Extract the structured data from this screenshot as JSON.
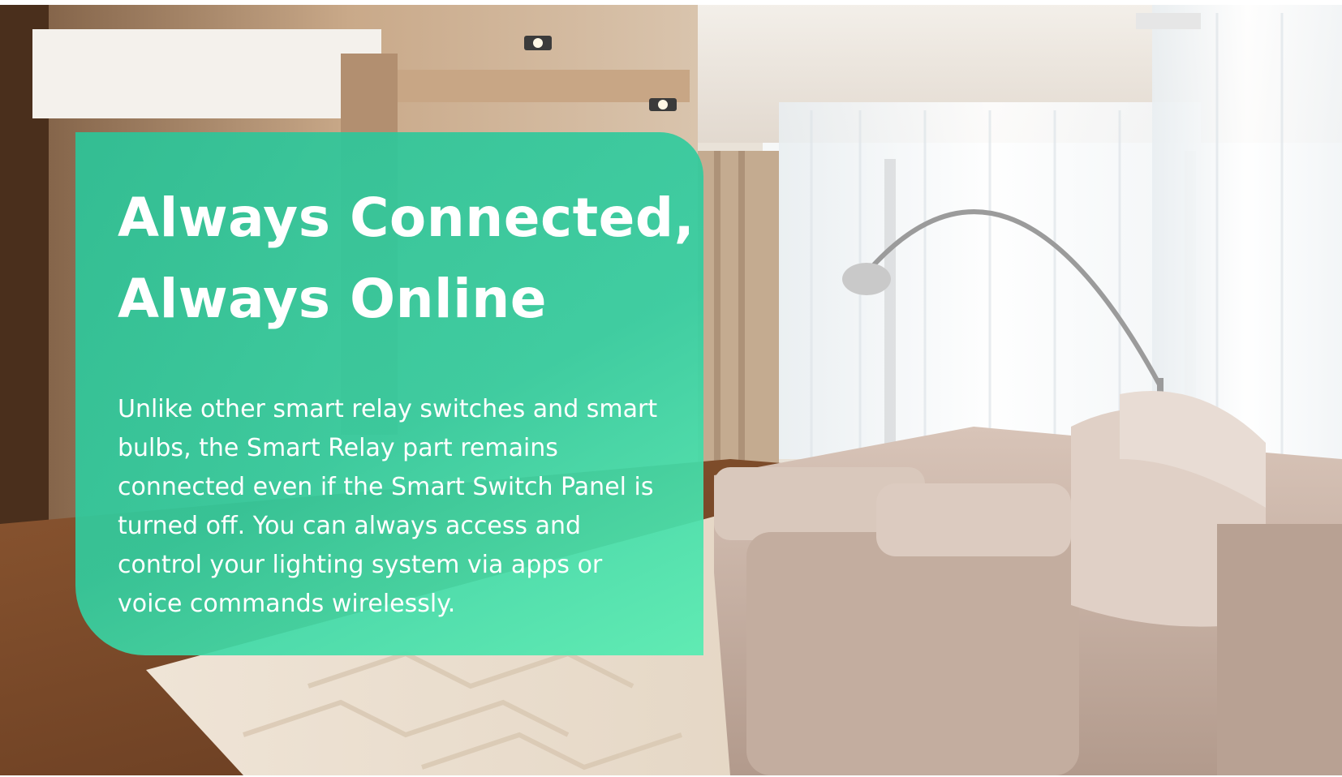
{
  "hero": {
    "headline_line1": "Always Connected,",
    "headline_line2": "Always Online",
    "body": "Unlike other smart relay switches and smart bulbs, the Smart Relay part remains connected even if the Smart Switch Panel is turned off. You can always access and control your lighting system via apps or voice commands wirelessly."
  },
  "colors": {
    "panel_teal": "#2cc498",
    "panel_mint": "#58ecb2",
    "text": "#ffffff"
  }
}
